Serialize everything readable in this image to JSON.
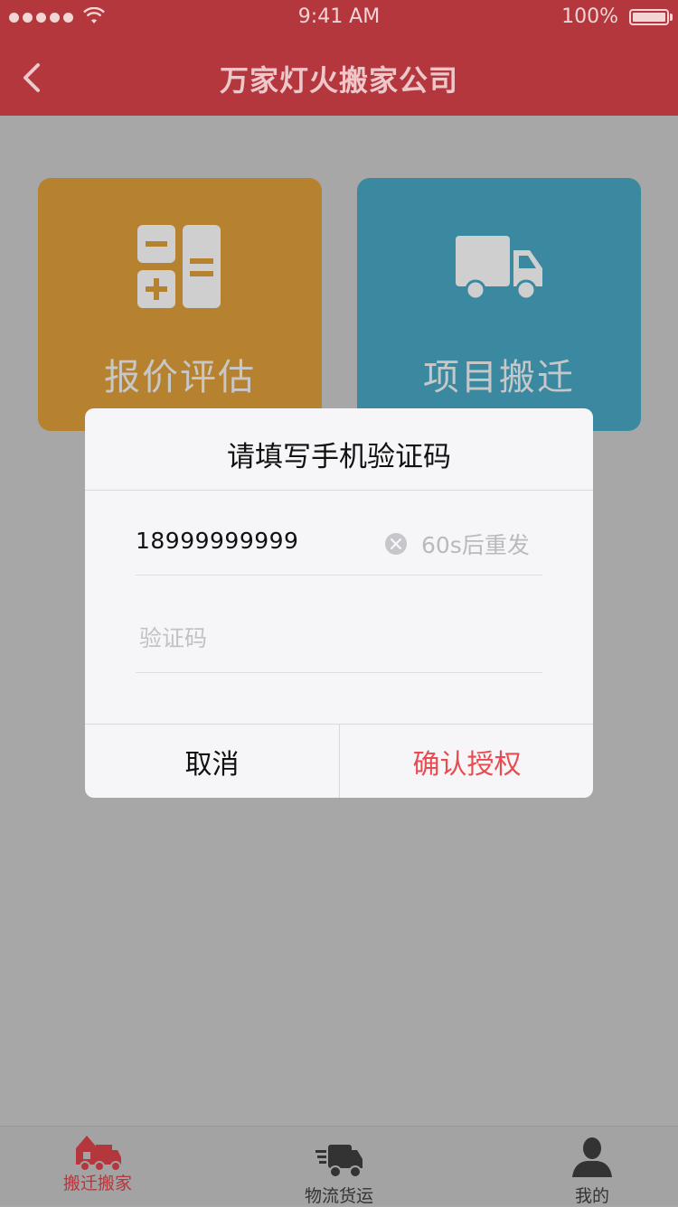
{
  "status_bar": {
    "time": "9:41 AM",
    "battery": "100%"
  },
  "nav": {
    "title": "万家灯火搬家公司"
  },
  "cards": [
    {
      "label": "报价评估",
      "icon": "calculator-icon",
      "color": "#b6822f"
    },
    {
      "label": "项目搬迁",
      "icon": "truck-icon",
      "color": "#3a89a1"
    }
  ],
  "dialog": {
    "title": "请填写手机验证码",
    "phone": "18999999999",
    "resend": "60s后重发",
    "code_placeholder": "验证码",
    "cancel": "取消",
    "confirm": "确认授权",
    "confirm_color": "#e84b52"
  },
  "tabs": [
    {
      "label": "搬迁搬家",
      "icon": "moving-house-icon",
      "active": true
    },
    {
      "label": "物流货运",
      "icon": "delivery-truck-icon",
      "active": false
    },
    {
      "label": "我的",
      "icon": "user-icon",
      "active": false
    }
  ],
  "colors": {
    "primary": "#b4373d",
    "overlay": "#a7a7a7"
  }
}
